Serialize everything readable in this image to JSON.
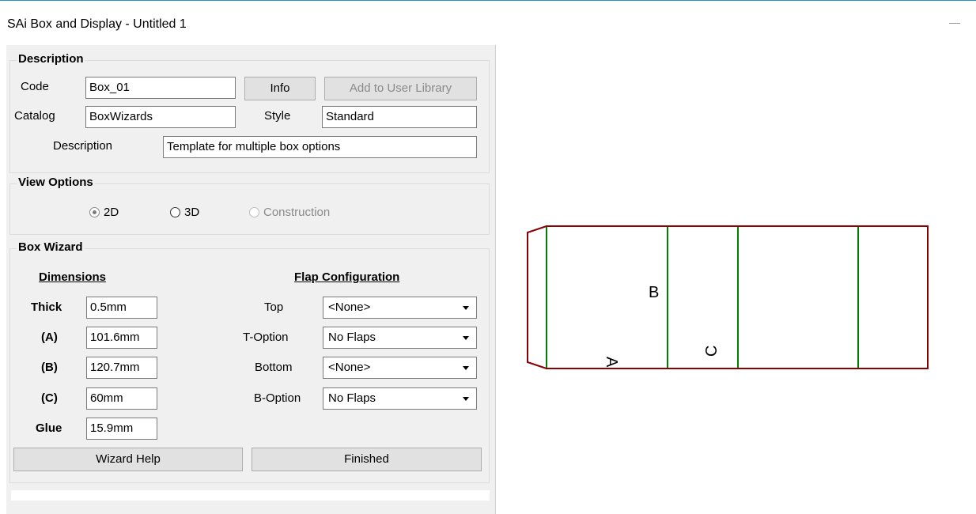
{
  "window": {
    "title": "SAi Box and Display - Untitled 1"
  },
  "description": {
    "group_title": "Description",
    "code_label": "Code",
    "code_value": "Box_01",
    "info_button": "Info",
    "add_library_button": "Add to User Library",
    "catalog_label": "Catalog",
    "catalog_value": "BoxWizards",
    "style_label": "Style",
    "style_value": "Standard",
    "description_label": "Description",
    "description_value": "Template for multiple box options"
  },
  "view_options": {
    "group_title": "View Options",
    "options": [
      {
        "label": "2D",
        "checked": true
      },
      {
        "label": "3D",
        "checked": false
      },
      {
        "label": "Construction",
        "checked": false,
        "disabled": true
      }
    ]
  },
  "box_wizard": {
    "group_title": "Box Wizard",
    "dimensions_heading": "Dimensions",
    "flap_heading": "Flap Configuration",
    "dimensions": [
      {
        "label": "Thick",
        "value": "0.5mm"
      },
      {
        "label": "(A)",
        "value": "101.6mm"
      },
      {
        "label": "(B)",
        "value": "120.7mm"
      },
      {
        "label": "(C)",
        "value": "60mm"
      },
      {
        "label": "Glue",
        "value": "15.9mm"
      }
    ],
    "flaps": [
      {
        "label": "Top",
        "value": "<None>"
      },
      {
        "label": "T-Option",
        "value": "No Flaps"
      },
      {
        "label": "Bottom",
        "value": "<None>"
      },
      {
        "label": "B-Option",
        "value": "No Flaps"
      }
    ],
    "help_button": "Wizard Help",
    "finished_button": "Finished"
  },
  "drawing": {
    "labels": [
      "B",
      "A",
      "C"
    ],
    "outline_color": "#8b0000",
    "fold_color": "#008000"
  }
}
